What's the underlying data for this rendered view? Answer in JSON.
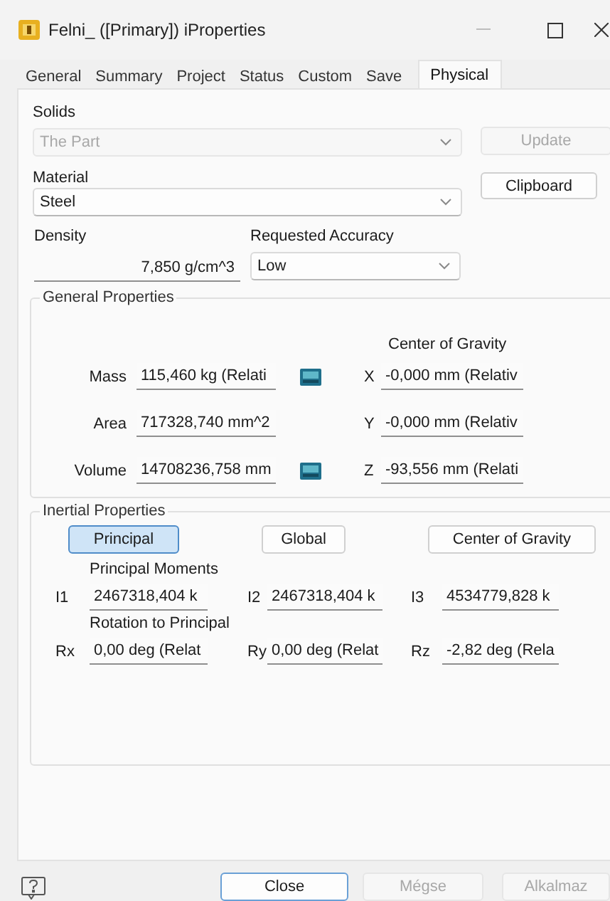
{
  "window": {
    "title": "Felni_ ([Primary]) iProperties"
  },
  "tabs": [
    {
      "label": "General",
      "selected": false
    },
    {
      "label": "Summary",
      "selected": false
    },
    {
      "label": "Project",
      "selected": false
    },
    {
      "label": "Status",
      "selected": false
    },
    {
      "label": "Custom",
      "selected": false
    },
    {
      "label": "Save",
      "selected": false
    },
    {
      "label": "Physical",
      "selected": true
    }
  ],
  "solids": {
    "label": "Solids",
    "value": "The Part",
    "disabled": true
  },
  "update_button": {
    "label": "Update",
    "disabled": true
  },
  "material": {
    "label": "Material",
    "value": "Steel",
    "disabled": false
  },
  "clipboard_button": {
    "label": "Clipboard",
    "disabled": false
  },
  "density": {
    "label": "Density",
    "value": "7,850 g/cm^3"
  },
  "requested_accuracy": {
    "label": "Requested Accuracy",
    "value": "Low",
    "disabled": false
  },
  "general_properties": {
    "title": "General Properties",
    "center_of_gravity_label": "Center of Gravity",
    "rows": [
      {
        "label": "Mass",
        "value": "115,460 kg (Relati",
        "has_icon": true,
        "axis": "X",
        "cog_value": "-0,000 mm (Relativ"
      },
      {
        "label": "Area",
        "value": "717328,740 mm^2",
        "has_icon": false,
        "axis": "Y",
        "cog_value": "-0,000 mm (Relativ"
      },
      {
        "label": "Volume",
        "value": "14708236,758 mm",
        "has_icon": true,
        "axis": "Z",
        "cog_value": "-93,556 mm (Relati"
      }
    ]
  },
  "inertial_properties": {
    "title": "Inertial Properties",
    "views": [
      {
        "label": "Principal",
        "selected": true
      },
      {
        "label": "Global",
        "selected": false
      },
      {
        "label": "Center of Gravity",
        "selected": false
      }
    ],
    "principal_moments": {
      "label": "Principal Moments",
      "items": [
        {
          "label": "I1",
          "value": "2467318,404 k"
        },
        {
          "label": "I2",
          "value": "2467318,404 k"
        },
        {
          "label": "I3",
          "value": "4534779,828 k"
        }
      ]
    },
    "rotation_to_principal": {
      "label": "Rotation to Principal",
      "items": [
        {
          "label": "Rx",
          "value": "0,00 deg (Relat"
        },
        {
          "label": "Ry",
          "value": "0,00 deg (Relat"
        },
        {
          "label": "Rz",
          "value": "-2,82 deg (Rela"
        }
      ]
    }
  },
  "footer": {
    "buttons": [
      {
        "label": "Close",
        "disabled": false,
        "default": true
      },
      {
        "label": "Mégse",
        "disabled": true,
        "default": false
      },
      {
        "label": "Alkalmaz",
        "disabled": true,
        "default": false
      }
    ]
  }
}
